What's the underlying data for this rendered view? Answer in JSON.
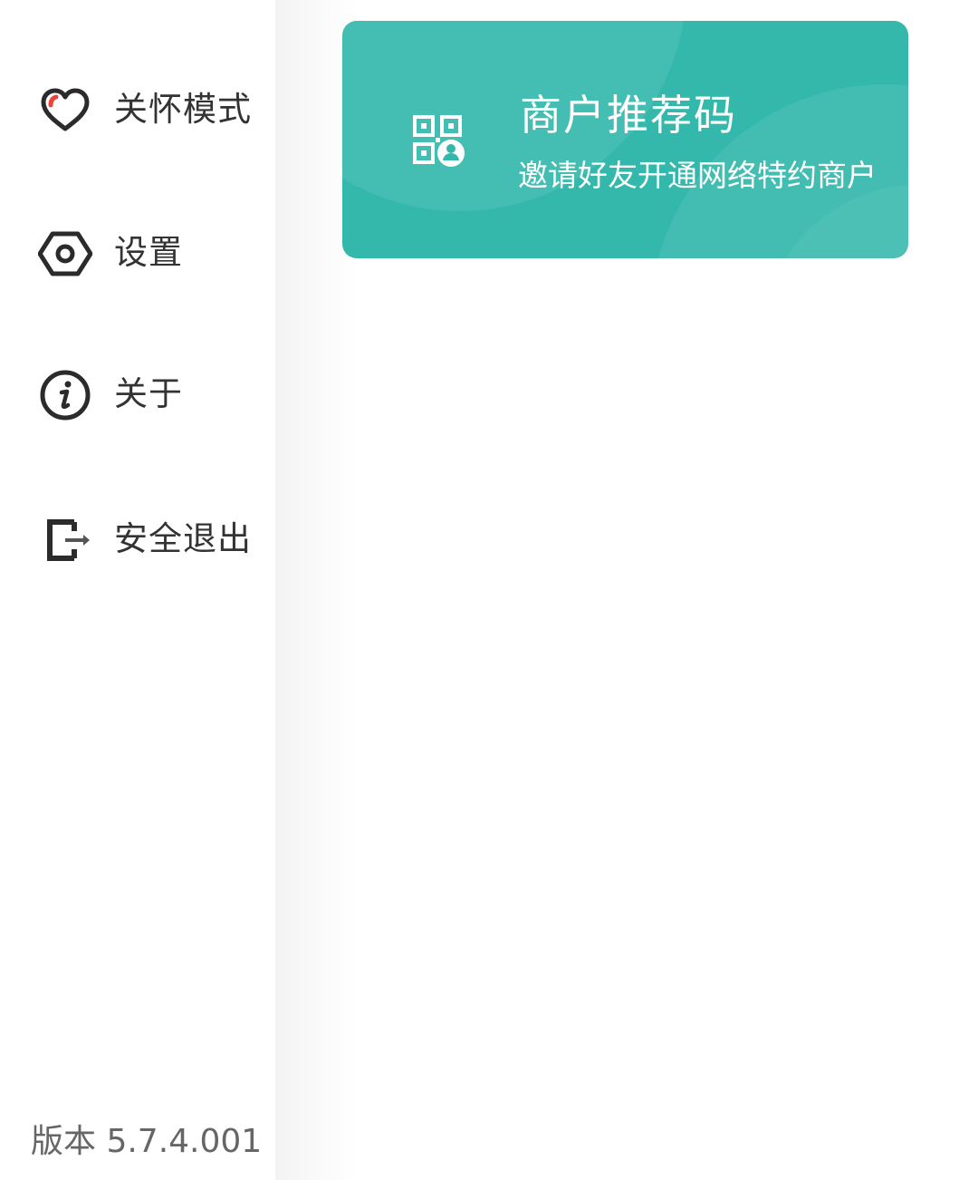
{
  "menu": {
    "items": [
      {
        "label": "关怀模式",
        "icon": "heart-icon"
      },
      {
        "label": "设置",
        "icon": "settings-hex-icon"
      },
      {
        "label": "关于",
        "icon": "info-icon"
      },
      {
        "label": "安全退出",
        "icon": "logout-icon"
      }
    ],
    "version": "版本 5.7.4.001"
  },
  "referral_card": {
    "title": "商户推荐码",
    "subtitle": "邀请好友开通网络特约商户",
    "icon": "qr-user-icon",
    "background_color": "#35b8ac"
  },
  "colors": {
    "text_primary": "#333333",
    "text_secondary": "#666666",
    "accent_red": "#e8443a",
    "teal": "#35b8ac"
  }
}
